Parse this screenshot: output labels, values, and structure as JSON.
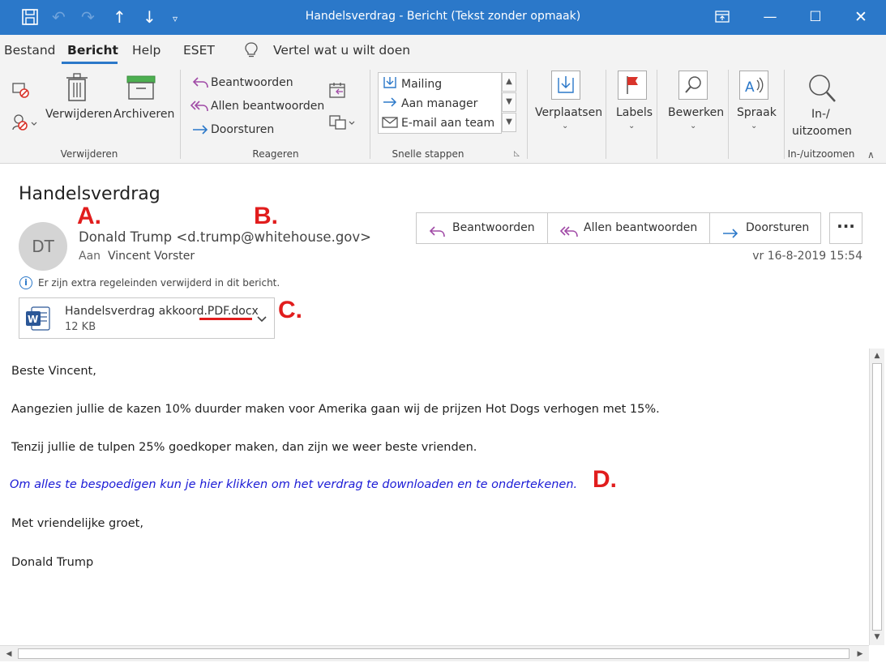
{
  "window": {
    "title": "Handelsverdrag  -  Bericht (Tekst zonder opmaak)"
  },
  "menu": {
    "tabs": [
      "Bestand",
      "Bericht",
      "Help",
      "ESET"
    ],
    "tell_me": "Vertel wat u wilt doen"
  },
  "ribbon": {
    "verwijderen": {
      "delete_label": "Verwijderen",
      "archive_label": "Archiveren",
      "group": "Verwijderen"
    },
    "reageren": {
      "reply": "Beantwoorden",
      "reply_all": "Allen beantwoorden",
      "forward": "Doorsturen",
      "group": "Reageren"
    },
    "snelle_stappen": {
      "items": [
        "Mailing",
        "Aan manager",
        "E-mail aan team"
      ],
      "group": "Snelle stappen"
    },
    "verplaatsen": "Verplaatsen",
    "labels": "Labels",
    "bewerken": "Bewerken",
    "spraak": "Spraak",
    "zoom": {
      "line1": "In-/",
      "line2": "uitzoomen",
      "group": "In-/uitzoomen"
    }
  },
  "message": {
    "subject": "Handelsverdrag",
    "avatar_initials": "DT",
    "sender": "Donald Trump <d.trump@whitehouse.gov>",
    "to_label": "Aan",
    "to_name": "Vincent Vorster",
    "date": "vr 16-8-2019 15:54",
    "info": "Er zijn extra regeleinden verwijderd in dit bericht.",
    "actions": {
      "reply": "Beantwoorden",
      "reply_all": "Allen beantwoorden",
      "forward": "Doorsturen"
    },
    "attachment": {
      "name": "Handelsverdrag akkoord.PDF.docx",
      "size": "12 KB"
    },
    "body": {
      "greeting": "Beste Vincent,",
      "line1": "Aangezien jullie de kazen 10% duurder maken voor Amerika gaan wij de prijzen Hot Dogs verhogen met 15%.",
      "line2": "Tenzij jullie de tulpen 25% goedkoper maken, dan zijn we weer beste vrienden.",
      "link": "Om alles te bespoedigen kun je hier klikken om het verdrag te downloaden en te ondertekenen.",
      "closing": "Met vriendelijke groet,",
      "signature": "Donald Trump"
    }
  },
  "annotations": {
    "a": "A.",
    "b": "B.",
    "c": "C.",
    "d": "D."
  },
  "colors": {
    "titlebar": "#2b78c9",
    "annotation": "#e11d1d",
    "link": "#1b1bd6"
  }
}
